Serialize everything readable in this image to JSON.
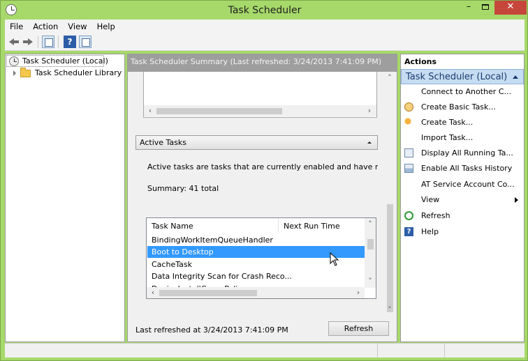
{
  "window": {
    "title": "Task Scheduler",
    "minimize_glyph": "–",
    "close_glyph": "✕"
  },
  "menu": [
    "File",
    "Action",
    "View",
    "Help"
  ],
  "toolbar": {
    "icons": [
      "back-icon",
      "forward-icon",
      "show-hide-console-tree-icon",
      "help-icon",
      "show-hide-action-pane-icon"
    ],
    "help_glyph": "?"
  },
  "tree": {
    "root_label": "Task Scheduler (Local)",
    "library_label": "Task Scheduler Library"
  },
  "center": {
    "summary_header": "Task Scheduler Summary (Last refreshed: 3/24/2013 7:41:09 PM)",
    "active_tasks": {
      "title": "Active Tasks",
      "description": "Active tasks are tasks that are currently enabled and have not",
      "summary": "Summary: 41 total",
      "columns": [
        "Task Name",
        "Next Run Time"
      ],
      "rows": [
        "BindingWorkItemQueueHandler",
        "Boot to Desktop",
        "CacheTask",
        "Data Integrity Scan for Crash Reco...",
        "DeviceInstallGroupPolicy"
      ],
      "selected_row": "Boot to Desktop"
    },
    "footer": {
      "last_refreshed": "Last refreshed at 3/24/2013 7:41:09 PM",
      "refresh_button": "Refresh"
    },
    "scroll_glyphs": {
      "left": "‹",
      "right": "›",
      "up": "˄",
      "down": "˅"
    }
  },
  "actions": {
    "title": "Actions",
    "group": "Task Scheduler (Local)",
    "items": [
      {
        "label": "Connect to Another C...",
        "icon": ""
      },
      {
        "label": "Create Basic Task...",
        "icon": "create-basic-task-icon"
      },
      {
        "label": "Create Task...",
        "icon": "create-task-icon"
      },
      {
        "label": "Import Task...",
        "icon": ""
      },
      {
        "label": "Display All Running Ta...",
        "icon": "display-running-icon"
      },
      {
        "label": "Enable All Tasks History",
        "icon": "tasks-history-icon"
      },
      {
        "label": "AT Service Account Co...",
        "icon": ""
      },
      {
        "label": "View",
        "icon": ""
      },
      {
        "label": "Refresh",
        "icon": "refresh-icon"
      },
      {
        "label": "Help",
        "icon": "help-icon"
      }
    ]
  },
  "colors": {
    "window_frame": "#a6d96a",
    "close_button": "#c7463c",
    "selection": "#3399ff",
    "actions_group_bg": "#c6dcf2"
  }
}
